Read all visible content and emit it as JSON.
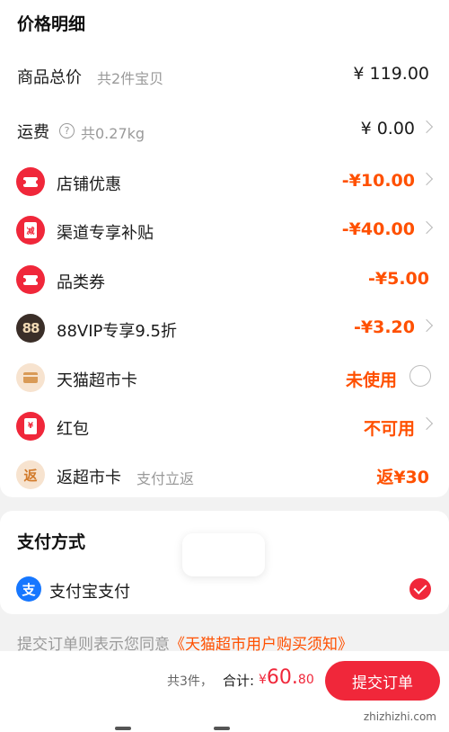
{
  "price_detail": {
    "title": "价格明细",
    "rows": [
      {
        "label": "商品总价",
        "sub": "共2件宝贝",
        "amount": "¥ 119.00"
      },
      {
        "label": "运费",
        "sub": "共0.27kg",
        "amount": "¥ 0.00"
      },
      {
        "label": "店铺优惠",
        "amount": "-¥10.00"
      },
      {
        "label": "渠道专享补贴",
        "amount": "-¥40.00"
      },
      {
        "label": "品类券",
        "amount": "-¥5.00"
      },
      {
        "label": "88VIP专享9.5折",
        "amount": "-¥3.20"
      },
      {
        "label": "天猫超市卡",
        "amount": "未使用"
      },
      {
        "label": "红包",
        "amount": "不可用"
      },
      {
        "label": "返超市卡",
        "sub": "支付立返",
        "amount": "返¥30"
      }
    ]
  },
  "icons": {
    "coupon_glyph": "",
    "envelope_text": "减",
    "vip_text": "88",
    "redpack_text": "¥",
    "rebate_text": "返",
    "help_text": "?",
    "alipay_text": "支"
  },
  "payment": {
    "title": "支付方式",
    "method": "支付宝支付"
  },
  "agreement": {
    "prefix": "提交订单则表示您同意",
    "link": "《天猫超市用户购买须知》"
  },
  "bottom_bar": {
    "count": "共3件，",
    "total_label": "合计:",
    "total_symbol": "¥",
    "total_int": "60.",
    "total_dec": "80",
    "submit_label": "提交订单"
  },
  "watermark": "zhizhizhi.com",
  "colors": {
    "accent_red": "#f0273a",
    "discount_orange": "#ff5000",
    "alipay_blue": "#1677ff"
  }
}
